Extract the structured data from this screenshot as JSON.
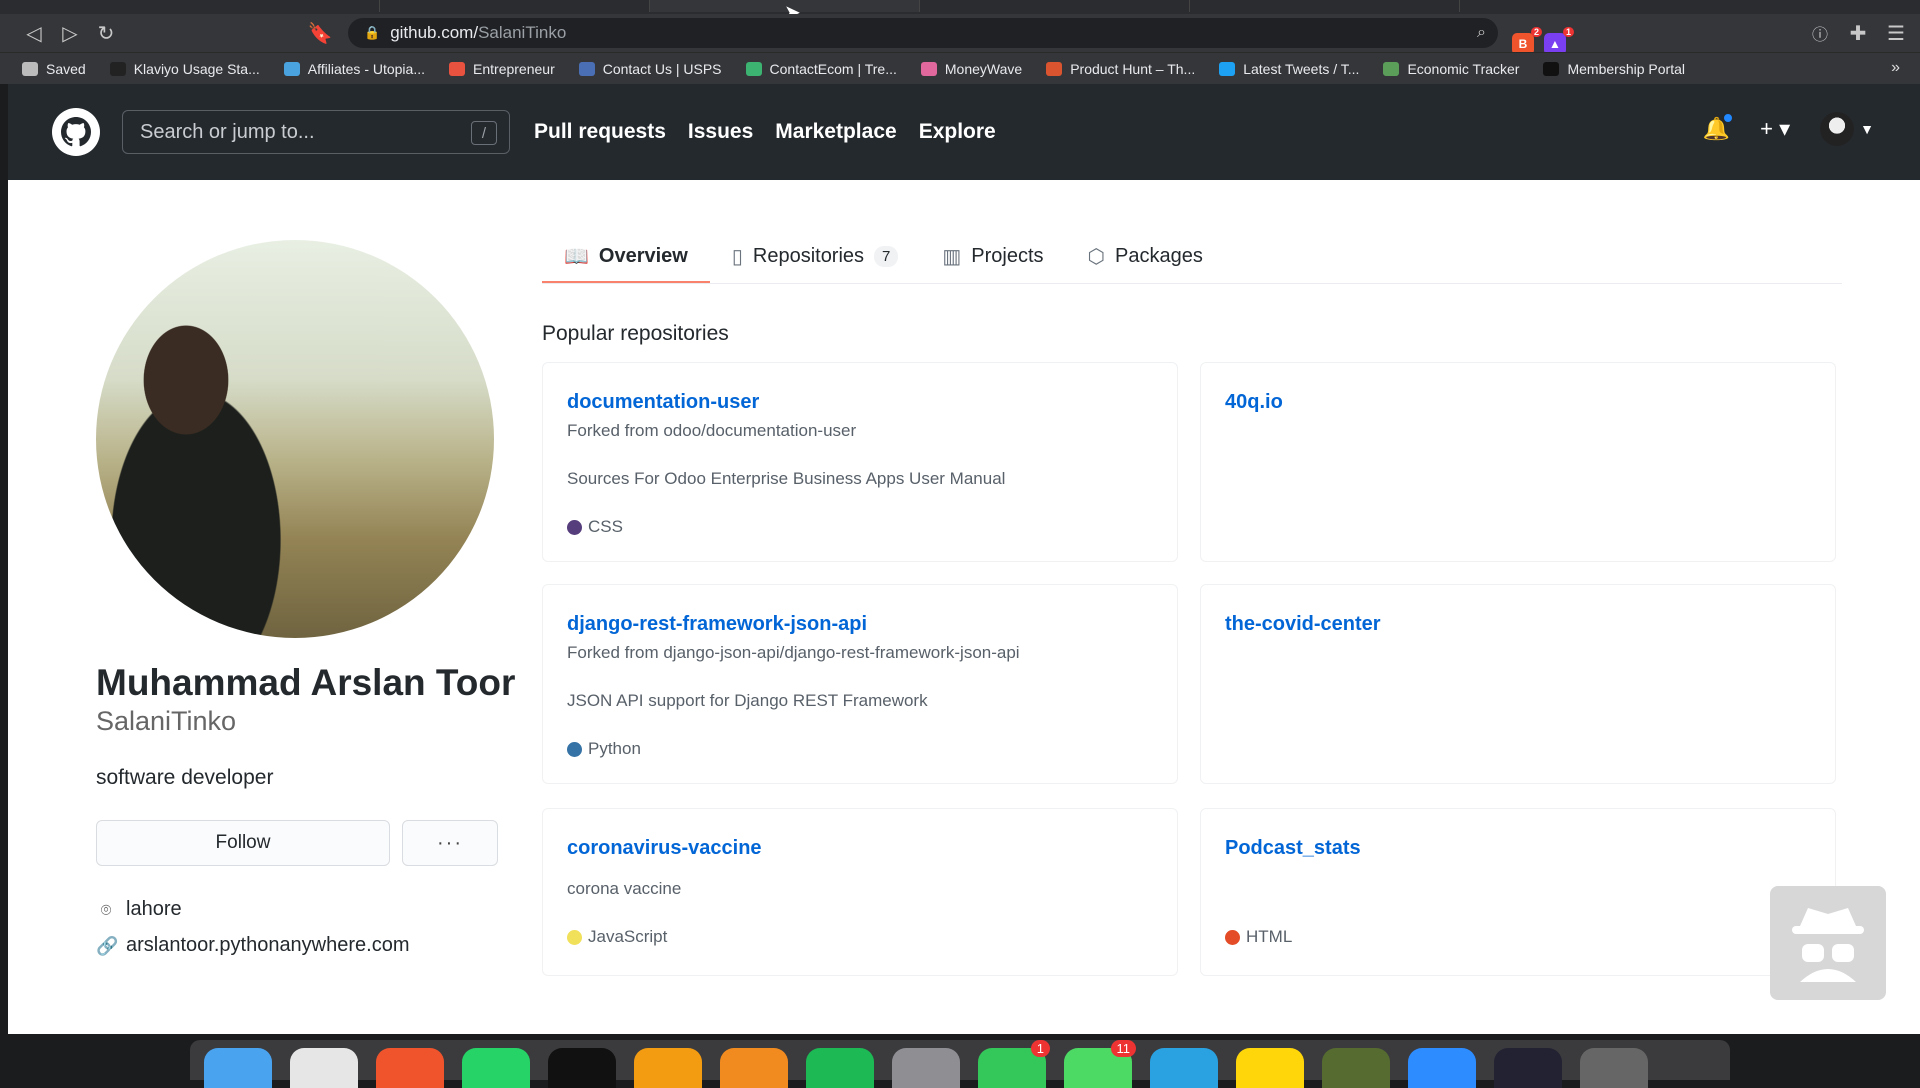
{
  "browser": {
    "url_host": "github.com/",
    "url_path": "SalaniTinko",
    "extension_counts": {
      "brave": "2",
      "alert": "1"
    }
  },
  "bookmarks": [
    {
      "label": "Saved",
      "color": "#bbbbbb"
    },
    {
      "label": "Klaviyo Usage Sta...",
      "color": "#222222"
    },
    {
      "label": "Affiliates - Utopia...",
      "color": "#4aa3df"
    },
    {
      "label": "Entrepreneur",
      "color": "#e8523f"
    },
    {
      "label": "Contact Us | USPS",
      "color": "#4b6fb5"
    },
    {
      "label": "ContactEcom | Tre...",
      "color": "#3cb371"
    },
    {
      "label": "MoneyWave",
      "color": "#e0689c"
    },
    {
      "label": "Product Hunt – Th...",
      "color": "#da552f"
    },
    {
      "label": "Latest Tweets / T...",
      "color": "#1da1f2"
    },
    {
      "label": "Economic Tracker",
      "color": "#5a9e5a"
    },
    {
      "label": "Membership Portal",
      "color": "#111111"
    }
  ],
  "header": {
    "search_placeholder": "Search or jump to...",
    "search_shortcut": "/",
    "nav": [
      "Pull requests",
      "Issues",
      "Marketplace",
      "Explore"
    ]
  },
  "profile": {
    "name": "Muhammad Arslan Toor",
    "login": "SalaniTinko",
    "bio": "software developer",
    "follow_label": "Follow",
    "more_label": "···",
    "location": "lahore",
    "website": "arslantoor.pythonanywhere.com"
  },
  "tabs": [
    {
      "label": "Overview",
      "icon": "book-icon"
    },
    {
      "label": "Repositories",
      "icon": "repo-icon",
      "count": "7"
    },
    {
      "label": "Projects",
      "icon": "project-icon"
    },
    {
      "label": "Packages",
      "icon": "package-icon"
    }
  ],
  "popular": {
    "title": "Popular repositories",
    "repos": [
      {
        "name": "documentation-user",
        "forked": "Forked from odoo/documentation-user",
        "desc": "Sources For Odoo Enterprise Business Apps User Manual",
        "lang": "CSS",
        "lang_color": "#563d7c"
      },
      {
        "name": "40q.io",
        "forked": "",
        "desc": "",
        "lang": "",
        "lang_color": ""
      },
      {
        "name": "django-rest-framework-json-api",
        "forked": "Forked from django-json-api/django-rest-framework-json-api",
        "desc": "JSON API support for Django REST Framework",
        "lang": "Python",
        "lang_color": "#3572A5"
      },
      {
        "name": "the-covid-center",
        "forked": "",
        "desc": "",
        "lang": "",
        "lang_color": ""
      },
      {
        "name": "coronavirus-vaccine",
        "forked": "",
        "desc": "corona vaccine",
        "lang": "JavaScript",
        "lang_color": "#f1e05a"
      },
      {
        "name": "Podcast_stats",
        "forked": "",
        "desc": "",
        "lang": "HTML",
        "lang_color": "#e34c26"
      }
    ]
  },
  "dock": {
    "badges": {
      "messages": "1",
      "whatsapp": "11"
    }
  }
}
